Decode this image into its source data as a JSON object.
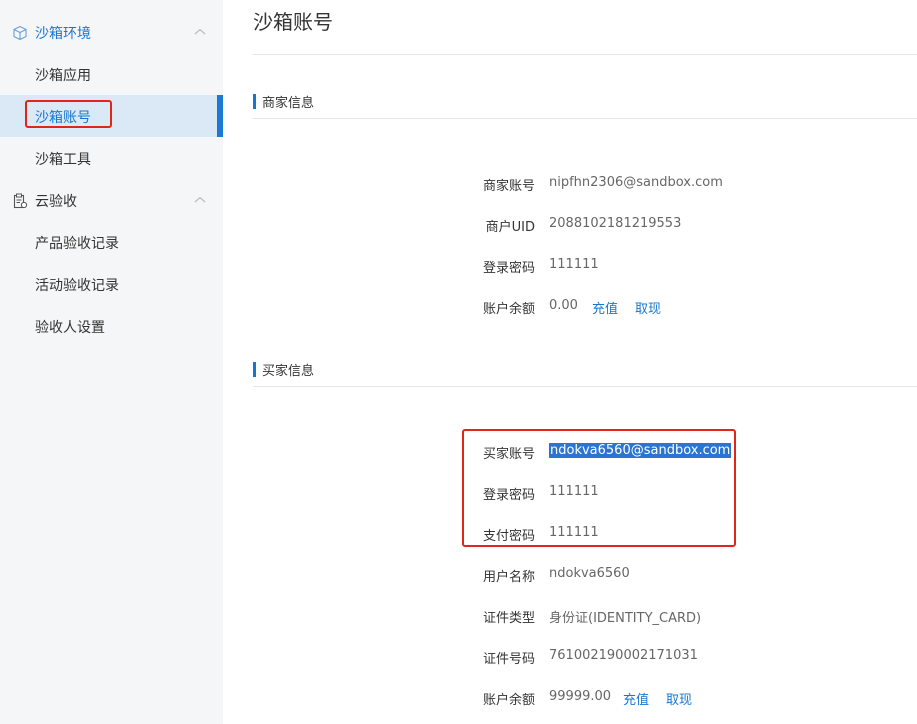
{
  "sidebar": {
    "groups": [
      {
        "label": "沙箱环境",
        "icon": "cube-icon",
        "items": [
          "沙箱应用",
          "沙箱账号",
          "沙箱工具"
        ]
      },
      {
        "label": "云验收",
        "icon": "clipboard-icon",
        "items": [
          "产品验收记录",
          "活动验收记录",
          "验收人设置"
        ]
      }
    ]
  },
  "main": {
    "title": "沙箱账号",
    "merchant": {
      "section": "商家信息",
      "account_label": "商家账号",
      "account": "nipfhn2306@sandbox.com",
      "uid_label": "商户UID",
      "uid": "2088102181219553",
      "password_label": "登录密码",
      "password": "111111",
      "balance_label": "账户余额",
      "balance": "0.00",
      "recharge": "充值",
      "withdraw": "取现"
    },
    "buyer": {
      "section": "买家信息",
      "account_label": "买家账号",
      "account": "ndokva6560@sandbox.com",
      "password_label": "登录密码",
      "password": "111111",
      "pay_password_label": "支付密码",
      "pay_password": "111111",
      "username_label": "用户名称",
      "username": "ndokva6560",
      "id_type_label": "证件类型",
      "id_type": "身份证(IDENTITY_CARD)",
      "id_no_label": "证件号码",
      "id_no": "761002190002171031",
      "balance_label": "账户余额",
      "balance": "99999.00",
      "recharge": "充值",
      "withdraw": "取现"
    }
  },
  "colors": {
    "accent": "#1677d2",
    "highlight_box": "#e0261b",
    "selection": "#2a75d2"
  }
}
